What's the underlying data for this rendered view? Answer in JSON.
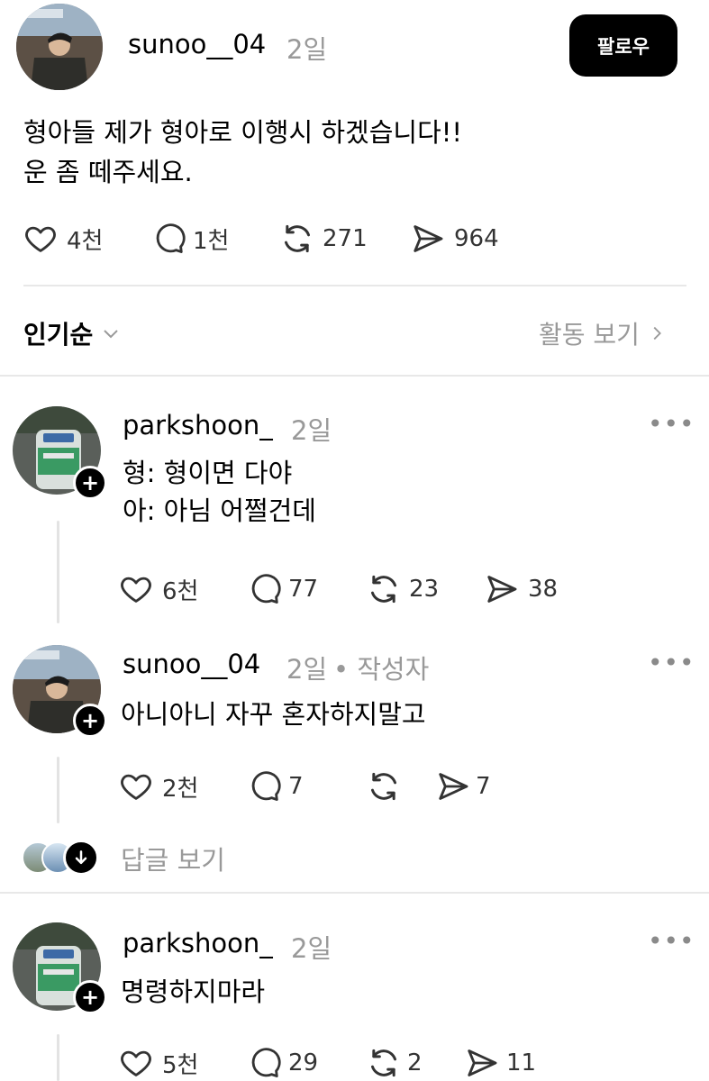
{
  "post": {
    "username": "sunoo__04",
    "time": "2일",
    "follow_label": "팔로우",
    "text_line1": "형아들 제가 형아로 이행시 하겠습니다!!",
    "text_line2": "운 좀 떼주세요.",
    "likes": "4천",
    "comments": "1천",
    "reposts": "271",
    "shares": "964"
  },
  "sort": {
    "label": "인기순",
    "activity_label": "활동 보기"
  },
  "replies": [
    {
      "username": "parkshoon_",
      "time": "2일",
      "line1": "형: 형이면 다야",
      "line2": "아: 아님 어쩔건데",
      "likes": "6천",
      "comments": "77",
      "reposts": "23",
      "shares": "38"
    },
    {
      "username": "sunoo__04",
      "time": "2일",
      "author_tag": "• 작성자",
      "line1": "아니아니 자꾸 혼자하지말고",
      "likes": "2천",
      "comments": "7",
      "reposts": "",
      "shares": "7"
    },
    {
      "username": "parkshoon_",
      "time": "2일",
      "line1": "명령하지마라",
      "likes": "5천",
      "comments": "29",
      "reposts": "2",
      "shares": "11"
    }
  ],
  "view_replies_label": "답글 보기",
  "icons": {
    "like": "heart-icon",
    "comment": "comment-bubble-icon",
    "repost": "repost-icon",
    "share": "send-icon",
    "more": "more-dots-icon",
    "chevron": "chevron-down-icon",
    "arrow": "chevron-right-icon"
  }
}
